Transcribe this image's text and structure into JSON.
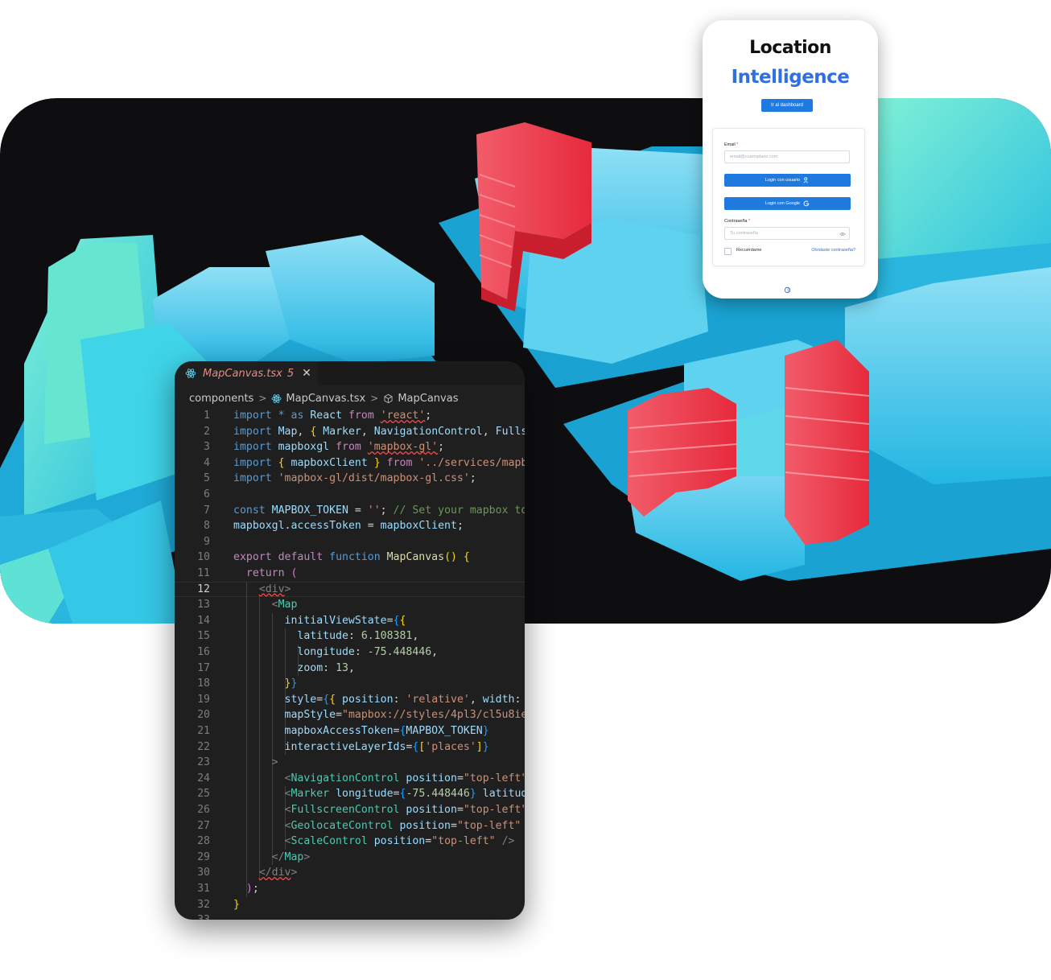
{
  "login": {
    "brand_line1": "Location",
    "brand_line2": "Intelligence",
    "dashboard_button": "Ir al dashboard",
    "email_label": "Email",
    "email_required": "*",
    "email_placeholder": "email@cuartoplano.com",
    "login_user_button": "Login con usuario",
    "login_google_button": "Login con Google",
    "password_label": "Contraseña",
    "password_required": "*",
    "password_placeholder": "Tu contraseña",
    "remember_label": "Recuérdame",
    "forgot_link": "Olvidaste contraseña?",
    "accent_color": "#1f7ae0",
    "brand_color": "#2f6fe0"
  },
  "editor": {
    "tab_filename": "MapCanvas.tsx",
    "tab_problem_count": "5",
    "tab_close": "✕",
    "breadcrumb": [
      "components",
      "MapCanvas.tsx",
      "MapCanvas"
    ],
    "current_line": 12,
    "lines": [
      {
        "n": "1"
      },
      {
        "n": "2"
      },
      {
        "n": "3"
      },
      {
        "n": "4"
      },
      {
        "n": "5"
      },
      {
        "n": "6"
      },
      {
        "n": "7"
      },
      {
        "n": "8"
      },
      {
        "n": "9"
      },
      {
        "n": "10"
      },
      {
        "n": "11"
      },
      {
        "n": "12"
      },
      {
        "n": "13"
      },
      {
        "n": "14"
      },
      {
        "n": "15"
      },
      {
        "n": "16"
      },
      {
        "n": "17"
      },
      {
        "n": "18"
      },
      {
        "n": "19"
      },
      {
        "n": "20"
      },
      {
        "n": "21"
      },
      {
        "n": "22"
      },
      {
        "n": "23"
      },
      {
        "n": "24"
      },
      {
        "n": "25"
      },
      {
        "n": "26"
      },
      {
        "n": "27"
      },
      {
        "n": "28"
      },
      {
        "n": "29"
      },
      {
        "n": "30"
      },
      {
        "n": "31"
      },
      {
        "n": "32"
      },
      {
        "n": "33"
      }
    ],
    "code": [
      [
        [
          "k",
          "import"
        ],
        [
          "p",
          " "
        ],
        [
          "k",
          "*"
        ],
        [
          "p",
          " "
        ],
        [
          "k",
          "as"
        ],
        [
          "p",
          " "
        ],
        [
          "v",
          "React"
        ],
        [
          "p",
          " "
        ],
        [
          "kc",
          "from"
        ],
        [
          "p",
          " "
        ],
        [
          "s~",
          "'react'"
        ],
        [
          "p",
          ";"
        ]
      ],
      [
        [
          "k",
          "import"
        ],
        [
          "p",
          " "
        ],
        [
          "v",
          "Map"
        ],
        [
          "p",
          ", "
        ],
        [
          "b1",
          "{"
        ],
        [
          "p",
          " "
        ],
        [
          "v",
          "Marker"
        ],
        [
          "p",
          ", "
        ],
        [
          "v",
          "NavigationControl"
        ],
        [
          "p",
          ", "
        ],
        [
          "v",
          "Fulls"
        ]
      ],
      [
        [
          "k",
          "import"
        ],
        [
          "p",
          " "
        ],
        [
          "v",
          "mapboxgl"
        ],
        [
          "p",
          " "
        ],
        [
          "kc",
          "from"
        ],
        [
          "p",
          " "
        ],
        [
          "s~",
          "'mapbox-gl'"
        ],
        [
          "p",
          ";"
        ]
      ],
      [
        [
          "k",
          "import"
        ],
        [
          "p",
          " "
        ],
        [
          "b1",
          "{"
        ],
        [
          "p",
          " "
        ],
        [
          "v",
          "mapboxClient"
        ],
        [
          "p",
          " "
        ],
        [
          "b1",
          "}"
        ],
        [
          "p",
          " "
        ],
        [
          "kc",
          "from"
        ],
        [
          "p",
          " "
        ],
        [
          "s",
          "'../services/mapb"
        ]
      ],
      [
        [
          "k",
          "import"
        ],
        [
          "p",
          " "
        ],
        [
          "s",
          "'mapbox-gl/dist/mapbox-gl.css'"
        ],
        [
          "p",
          ";"
        ]
      ],
      [],
      [
        [
          "k",
          "const"
        ],
        [
          "p",
          " "
        ],
        [
          "v",
          "MAPBOX_TOKEN"
        ],
        [
          "p",
          " = "
        ],
        [
          "s",
          "''"
        ],
        [
          "p",
          "; "
        ],
        [
          "c",
          "// Set your mapbox to"
        ]
      ],
      [
        [
          "v",
          "mapboxgl"
        ],
        [
          "p",
          "."
        ],
        [
          "v",
          "accessToken"
        ],
        [
          "p",
          " = "
        ],
        [
          "v",
          "mapboxClient"
        ],
        [
          "p",
          ";"
        ]
      ],
      [],
      [
        [
          "kc",
          "export"
        ],
        [
          "p",
          " "
        ],
        [
          "kc",
          "default"
        ],
        [
          "p",
          " "
        ],
        [
          "k",
          "function"
        ],
        [
          "p",
          " "
        ],
        [
          "f",
          "MapCanvas"
        ],
        [
          "b1",
          "()"
        ],
        [
          "p",
          " "
        ],
        [
          "b1",
          "{"
        ]
      ],
      [
        [
          "p",
          "  "
        ],
        [
          "kc",
          "return"
        ],
        [
          "p",
          " "
        ],
        [
          "b2",
          "("
        ]
      ],
      [
        [
          "p",
          "    "
        ],
        [
          "tg~",
          "<div"
        ],
        [
          "tg",
          ">"
        ]
      ],
      [
        [
          "p",
          "      "
        ],
        [
          "tg",
          "<"
        ],
        [
          "tn",
          "Map"
        ]
      ],
      [
        [
          "p",
          "        "
        ],
        [
          "v",
          "initialViewState"
        ],
        [
          "p",
          "="
        ],
        [
          "b3",
          "{"
        ],
        [
          "b1",
          "{"
        ]
      ],
      [
        [
          "p",
          "          "
        ],
        [
          "v",
          "latitude"
        ],
        [
          "p",
          ": "
        ],
        [
          "n",
          "6.108381"
        ],
        [
          "p",
          ","
        ]
      ],
      [
        [
          "p",
          "          "
        ],
        [
          "v",
          "longitude"
        ],
        [
          "p",
          ": "
        ],
        [
          "n",
          "-75.448446"
        ],
        [
          "p",
          ","
        ]
      ],
      [
        [
          "p",
          "          "
        ],
        [
          "v",
          "zoom"
        ],
        [
          "p",
          ": "
        ],
        [
          "n",
          "13"
        ],
        [
          "p",
          ","
        ]
      ],
      [
        [
          "p",
          "        "
        ],
        [
          "b1",
          "}"
        ],
        [
          "b3",
          "}"
        ]
      ],
      [
        [
          "p",
          "        "
        ],
        [
          "v",
          "style"
        ],
        [
          "p",
          "="
        ],
        [
          "b3",
          "{"
        ],
        [
          "b1",
          "{"
        ],
        [
          "p",
          " "
        ],
        [
          "v",
          "position"
        ],
        [
          "p",
          ": "
        ],
        [
          "s",
          "'relative'"
        ],
        [
          "p",
          ", "
        ],
        [
          "v",
          "width"
        ],
        [
          "p",
          ":"
        ]
      ],
      [
        [
          "p",
          "        "
        ],
        [
          "v",
          "mapStyle"
        ],
        [
          "p",
          "="
        ],
        [
          "s",
          "\"mapbox://styles/4pl3/cl5u8ie"
        ]
      ],
      [
        [
          "p",
          "        "
        ],
        [
          "v",
          "mapboxAccessToken"
        ],
        [
          "p",
          "="
        ],
        [
          "b3",
          "{"
        ],
        [
          "v",
          "MAPBOX_TOKEN"
        ],
        [
          "b3",
          "}"
        ]
      ],
      [
        [
          "p",
          "        "
        ],
        [
          "v",
          "interactiveLayerIds"
        ],
        [
          "p",
          "="
        ],
        [
          "b3",
          "{"
        ],
        [
          "b1",
          "["
        ],
        [
          "s",
          "'places'"
        ],
        [
          "b1",
          "]"
        ],
        [
          "b3",
          "}"
        ]
      ],
      [
        [
          "p",
          "      "
        ],
        [
          "tg",
          ">"
        ]
      ],
      [
        [
          "p",
          "        "
        ],
        [
          "tg",
          "<"
        ],
        [
          "tn",
          "NavigationControl"
        ],
        [
          "p",
          " "
        ],
        [
          "v",
          "position"
        ],
        [
          "p",
          "="
        ],
        [
          "s",
          "\"top-left\""
        ]
      ],
      [
        [
          "p",
          "        "
        ],
        [
          "tg",
          "<"
        ],
        [
          "tn",
          "Marker"
        ],
        [
          "p",
          " "
        ],
        [
          "v",
          "longitude"
        ],
        [
          "p",
          "="
        ],
        [
          "b3",
          "{"
        ],
        [
          "n",
          "-75.448446"
        ],
        [
          "b3",
          "}"
        ],
        [
          "p",
          " "
        ],
        [
          "v",
          "latitud"
        ]
      ],
      [
        [
          "p",
          "        "
        ],
        [
          "tg",
          "<"
        ],
        [
          "tn",
          "FullscreenControl"
        ],
        [
          "p",
          " "
        ],
        [
          "v",
          "position"
        ],
        [
          "p",
          "="
        ],
        [
          "s",
          "\"top-left\""
        ]
      ],
      [
        [
          "p",
          "        "
        ],
        [
          "tg",
          "<"
        ],
        [
          "tn",
          "GeolocateControl"
        ],
        [
          "p",
          " "
        ],
        [
          "v",
          "position"
        ],
        [
          "p",
          "="
        ],
        [
          "s",
          "\"top-left\""
        ]
      ],
      [
        [
          "p",
          "        "
        ],
        [
          "tg",
          "<"
        ],
        [
          "tn",
          "ScaleControl"
        ],
        [
          "p",
          " "
        ],
        [
          "v",
          "position"
        ],
        [
          "p",
          "="
        ],
        [
          "s",
          "\"top-left\""
        ],
        [
          "p",
          " "
        ],
        [
          "tg",
          "/>"
        ]
      ],
      [
        [
          "p",
          "      "
        ],
        [
          "tg",
          "</"
        ],
        [
          "tn",
          "Map"
        ],
        [
          "tg",
          ">"
        ]
      ],
      [
        [
          "p",
          "    "
        ],
        [
          "tg~",
          "</div"
        ],
        [
          "tg",
          ">"
        ]
      ],
      [
        [
          "p",
          "  "
        ],
        [
          "b2",
          ")"
        ],
        [
          "p",
          ";"
        ]
      ],
      [
        [
          "b1",
          "}"
        ]
      ],
      []
    ]
  }
}
